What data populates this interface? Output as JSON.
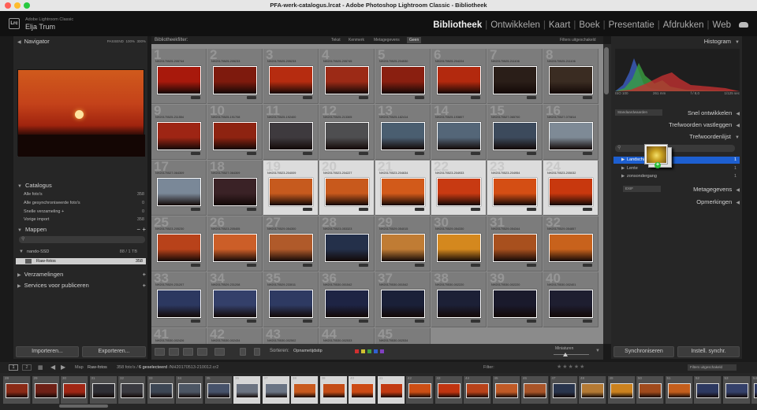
{
  "window": {
    "title": "PFA-werk-catalogus.lrcat - Adobe Photoshop Lightroom Classic - Bibliotheek"
  },
  "identity": {
    "logo": "Lrc",
    "catalog": "Adobe Lightroom Classic",
    "user": "Elja Trum"
  },
  "modules": [
    "Bibliotheek",
    "Ontwikkelen",
    "Kaart",
    "Boek",
    "Presentatie",
    "Afdrukken",
    "Web"
  ],
  "navigator": {
    "title": "Navigator",
    "zoom_options": [
      "PASSEND",
      "100%",
      "300%"
    ]
  },
  "catalog": {
    "title": "Catalogus",
    "items": [
      {
        "label": "Alle foto's",
        "count": "358"
      },
      {
        "label": "Alle gesynchroniseerde foto's",
        "count": "0"
      },
      {
        "label": "Snelle verzameling +",
        "count": "0"
      },
      {
        "label": "Vorige import",
        "count": "358"
      }
    ]
  },
  "folders": {
    "title": "Mappen",
    "volume": "nando-SSD",
    "volume_info": "88 / 1 TB",
    "folder": "Raw-fotos",
    "folder_count": "358"
  },
  "collections": {
    "title": "Verzamelingen"
  },
  "publish": {
    "title": "Services voor publiceren"
  },
  "left_buttons": {
    "import": "Importeren...",
    "export": "Exporteren..."
  },
  "filter_bar": {
    "label": "Bibliotheekfilter:",
    "options": [
      "Tekst",
      "Kenmerk",
      "Metagegevens",
      "Geen"
    ],
    "active": "Geen",
    "preset": "Filters uitgeschakeld"
  },
  "grid": {
    "cells": [
      {
        "n": "1",
        "f": "NH20170525-205744",
        "c": "#a8190c"
      },
      {
        "n": "2",
        "f": "NH20170525-205233",
        "c": "#7e1a0d"
      },
      {
        "n": "3",
        "f": "NH20170525-205233",
        "c": "#b62c10"
      },
      {
        "n": "4",
        "f": "NH20170525-205745",
        "c": "#9c2a16"
      },
      {
        "n": "5",
        "f": "NH20170525-204530",
        "c": "#8a1f10"
      },
      {
        "n": "6",
        "f": "NH20170525-204224",
        "c": "#b3290e"
      },
      {
        "n": "7",
        "f": "NH20170525-211106",
        "c": "#2a1e18"
      },
      {
        "n": "8",
        "f": "NH20170525-211106",
        "c": "#3a2c22"
      },
      {
        "n": "9",
        "f": "NH20170525-211554",
        "c": "#9e2514"
      },
      {
        "n": "10",
        "f": "NH20170525-191708",
        "c": "#8e2311"
      },
      {
        "n": "11",
        "f": "NH20170525-192400",
        "c": "#3e3a3e"
      },
      {
        "n": "12",
        "f": "NH20170525-213305",
        "c": "#4e4e50"
      },
      {
        "n": "13",
        "f": "NH20170525-182414",
        "c": "#4a5e70"
      },
      {
        "n": "14",
        "f": "NH20170525-193807",
        "c": "#546678"
      },
      {
        "n": "15",
        "f": "NH20170527-065700",
        "c": "#3c4a5c"
      },
      {
        "n": "16",
        "f": "NH20170527-070814",
        "c": "#7e8a96"
      },
      {
        "n": "17",
        "f": "NH20170527-064309",
        "c": "#7a8898"
      },
      {
        "n": "18",
        "f": "NH20170527-064309",
        "c": "#3a2226"
      },
      {
        "n": "19",
        "f": "NH20170523-204009",
        "c": "#c65a1e"
      },
      {
        "n": "20",
        "f": "NH20170523-204227",
        "c": "#c8591c"
      },
      {
        "n": "21",
        "f": "NH20170523-204634",
        "c": "#d25a1a"
      },
      {
        "n": "22",
        "f": "NH20170523-204933",
        "c": "#c83a12"
      },
      {
        "n": "23",
        "f": "NH20170523-204954",
        "c": "#d44e14"
      },
      {
        "n": "24",
        "f": "NH20170523-205032",
        "c": "#c8380e"
      },
      {
        "n": "25",
        "f": "NH20170523-205230",
        "c": "#b8421a"
      },
      {
        "n": "26",
        "f": "NH20170523-205405",
        "c": "#cc5e28"
      },
      {
        "n": "27",
        "f": "NH20170529-054300",
        "c": "#b05a2a"
      },
      {
        "n": "28",
        "f": "NH20170523-053323",
        "c": "#24304a"
      },
      {
        "n": "29",
        "f": "NH20170529-054015",
        "c": "#c07c34"
      },
      {
        "n": "30",
        "f": "NH20170529-054330",
        "c": "#d4881e"
      },
      {
        "n": "31",
        "f": "NH20170529-054344",
        "c": "#a8501e"
      },
      {
        "n": "32",
        "f": "NH20170529-054857",
        "c": "#c8621c"
      },
      {
        "n": "33",
        "f": "NH20170529-231207",
        "c": "#2c3860"
      },
      {
        "n": "34",
        "f": "NH20170529-231208",
        "c": "#34406a"
      },
      {
        "n": "35",
        "f": "NH20170529-233011",
        "c": "#2e3a62"
      },
      {
        "n": "36",
        "f": "NH20170530-001542",
        "c": "#1e2444"
      },
      {
        "n": "37",
        "f": "NH20170530-001542",
        "c": "#1a2038"
      },
      {
        "n": "38",
        "f": "NH20170530-002220",
        "c": "#1c2036"
      },
      {
        "n": "39",
        "f": "NH20170530-002220",
        "c": "#1a1a2c"
      },
      {
        "n": "40",
        "f": "NH20170530-002401",
        "c": "#1e1e30"
      },
      {
        "n": "41",
        "f": "NH20170530-002426",
        "c": "#707070"
      },
      {
        "n": "42",
        "f": "NH20170530-002434",
        "c": "#747474"
      },
      {
        "n": "43",
        "f": "NH20170530-002502",
        "c": "#686868"
      },
      {
        "n": "44",
        "f": "NH20170530-002533",
        "c": "#6c6c6c"
      },
      {
        "n": "45",
        "f": "NH20170530-002534",
        "c": "#606060"
      }
    ]
  },
  "toolbar": {
    "sort_label": "Sorteren:",
    "sort_value": "Opnametijdstip",
    "thumb_label": "Miniaturen"
  },
  "label_colors": [
    "#d03030",
    "#d0c030",
    "#40a040",
    "#3060d0",
    "#8040c0"
  ],
  "right_panel": {
    "histogram": {
      "title": "Histogram",
      "info": [
        "ISO 100",
        "261 mm",
        "f / 8,0",
        "1/125 sec"
      ]
    },
    "quick_develop": {
      "title": "Snel ontwikkelen",
      "preset": "Standaardwaarden"
    },
    "keywording": {
      "title": "Trefwoorden vastleggen"
    },
    "keyword_list": {
      "title": "Trefwoordenlijst",
      "items": [
        {
          "label": "Landschap",
          "count": "1"
        },
        {
          "label": "Lente",
          "count": "1"
        },
        {
          "label": "zonsondergang",
          "count": "1"
        }
      ]
    },
    "metadata": {
      "title": "Metagegevens",
      "preset": "EXIF"
    },
    "comments": {
      "title": "Opmerkingen"
    },
    "buttons": {
      "sync": "Synchroniseren",
      "auto_sync": "Instell. synchr."
    }
  },
  "filmstrip_bar": {
    "pages": [
      "1",
      "2"
    ],
    "path_label": "Map",
    "folder": "Raw-fotos",
    "count_text": "358 foto's /",
    "selected_text": "6 geselecteerd",
    "file_text": "/NH20170513-210012.cr2",
    "filter_label": "Filter:",
    "filter_preset": "Filters uitgeschakeld"
  },
  "filmstrip": {
    "cells": [
      {
        "n": "28",
        "c": "#8a2a16"
      },
      {
        "n": "29",
        "c": "#6e2016"
      },
      {
        "n": "30",
        "c": "#a02614"
      },
      {
        "n": "31",
        "c": "#2e2e34"
      },
      {
        "n": "32",
        "c": "#3a3a40"
      },
      {
        "n": "33",
        "c": "#3c4654"
      },
      {
        "n": "34",
        "c": "#4c5664"
      },
      {
        "n": "35",
        "c": "#46526a"
      },
      {
        "n": "36",
        "c": "#6c7482"
      },
      {
        "n": "37",
        "c": "#6a7484"
      },
      {
        "n": "38",
        "c": "#c85a1e"
      },
      {
        "n": "39",
        "c": "#c44c16"
      },
      {
        "n": "40",
        "c": "#cc4a14"
      },
      {
        "n": "41",
        "c": "#c23a12"
      },
      {
        "n": "42",
        "c": "#cc4e14"
      },
      {
        "n": "43",
        "c": "#c03410"
      },
      {
        "n": "44",
        "c": "#b8421a"
      },
      {
        "n": "45",
        "c": "#c05a26"
      },
      {
        "n": "46",
        "c": "#a85428"
      },
      {
        "n": "47",
        "c": "#28344c"
      },
      {
        "n": "48",
        "c": "#b47a34"
      },
      {
        "n": "49",
        "c": "#cc821e"
      },
      {
        "n": "50",
        "c": "#a04a1c"
      },
      {
        "n": "51",
        "c": "#c45e1c"
      },
      {
        "n": "52",
        "c": "#2c3860"
      },
      {
        "n": "53",
        "c": "#34406a"
      },
      {
        "n": "54",
        "c": "#2e3a62"
      },
      {
        "n": "55",
        "c": "#1e2444"
      },
      {
        "n": "56",
        "c": "#1a2038"
      },
      {
        "n": "57",
        "c": "#1c2036"
      }
    ]
  }
}
